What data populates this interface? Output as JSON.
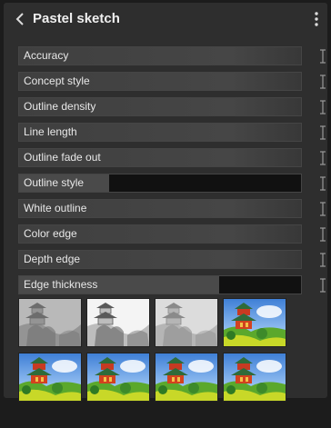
{
  "panel": {
    "title": "Pastel sketch",
    "back_icon": "chevron-left-icon",
    "menu_icon": "vertical-ellipsis-icon"
  },
  "sliders": [
    {
      "label": "Accuracy",
      "value": 1.0
    },
    {
      "label": "Concept style",
      "value": 1.0
    },
    {
      "label": "Outline density",
      "value": 1.0
    },
    {
      "label": "Line length",
      "value": 1.0
    },
    {
      "label": "Outline fade out",
      "value": 1.0
    },
    {
      "label": "Outline style",
      "value": 0.32
    },
    {
      "label": "White outline",
      "value": 1.0
    },
    {
      "label": "Color edge",
      "value": 1.0
    },
    {
      "label": "Depth edge",
      "value": 1.0
    },
    {
      "label": "Edge thickness",
      "value": 0.71
    }
  ],
  "reset_icon": "i-beam-reset-icon",
  "presets": [
    {
      "name": "preset-1",
      "style": "gray-sketch"
    },
    {
      "name": "preset-2",
      "style": "light-sketch"
    },
    {
      "name": "preset-3",
      "style": "soft-gray"
    },
    {
      "name": "preset-4",
      "style": "color"
    },
    {
      "name": "preset-5",
      "style": "color"
    },
    {
      "name": "preset-6",
      "style": "color"
    },
    {
      "name": "preset-7",
      "style": "color"
    },
    {
      "name": "preset-8",
      "style": "color"
    }
  ],
  "colors": {
    "panel_bg": "#2e2e2e",
    "slider_fill": "#4a4a4a",
    "slider_bg": "#111111",
    "title": "#efefef"
  }
}
